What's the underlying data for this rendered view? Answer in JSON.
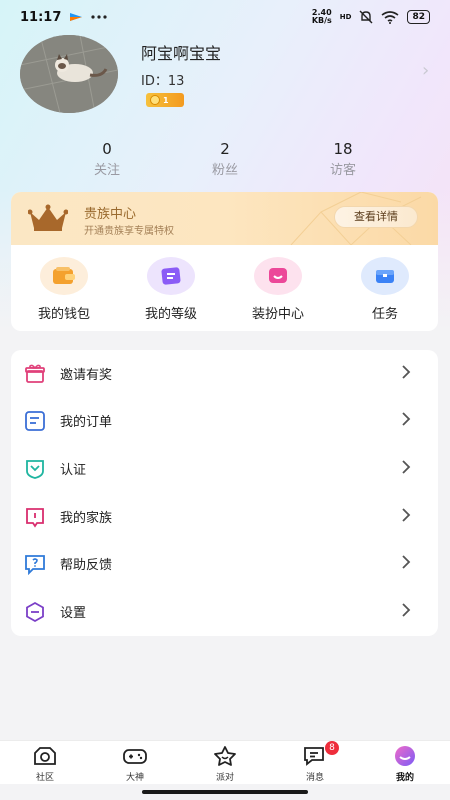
{
  "status_bar": {
    "time": "11:17",
    "net_speed": "2.40",
    "net_speed_unit": "KB/s",
    "network_type": "HD",
    "battery": "82",
    "icons": [
      "app-notification-icon",
      "more-icon",
      "mute-icon",
      "wifi-icon",
      "battery-icon"
    ]
  },
  "profile": {
    "username": "阿宝啊宝宝",
    "id_label": "ID：13",
    "level": "1"
  },
  "stats": [
    {
      "value": "0",
      "label": "关注"
    },
    {
      "value": "2",
      "label": "粉丝"
    },
    {
      "value": "18",
      "label": "访客"
    }
  ],
  "vip": {
    "title": "贵族中心",
    "subtitle": "开通贵族享专属特权",
    "button": "查看详情"
  },
  "features": [
    {
      "label": "我的钱包",
      "icon": "wallet-icon",
      "color": "#f39a2c"
    },
    {
      "label": "我的等级",
      "icon": "level-icon",
      "color": "#8b5cf6"
    },
    {
      "label": "装扮中心",
      "icon": "dress-up-icon",
      "color": "#ec4899"
    },
    {
      "label": "任务",
      "icon": "task-icon",
      "color": "#3b82f6"
    }
  ],
  "menu": [
    {
      "label": "邀请有奖",
      "icon": "gift-icon",
      "color": "#e0407a"
    },
    {
      "label": "我的订单",
      "icon": "order-icon",
      "color": "#3b6fd6"
    },
    {
      "label": "认证",
      "icon": "verify-icon",
      "color": "#1fb5a0"
    },
    {
      "label": "我的家族",
      "icon": "family-icon",
      "color": "#d92e6e"
    },
    {
      "label": "帮助反馈",
      "icon": "help-icon",
      "color": "#2f7ad9"
    },
    {
      "label": "设置",
      "icon": "settings-icon",
      "color": "#7b3fc7"
    }
  ],
  "bottom_nav": [
    {
      "label": "社区",
      "icon": "community-icon"
    },
    {
      "label": "大神",
      "icon": "gamepad-icon"
    },
    {
      "label": "派对",
      "icon": "party-icon"
    },
    {
      "label": "消息",
      "icon": "message-icon",
      "badge": "8"
    },
    {
      "label": "我的",
      "icon": "me-icon",
      "active": true
    }
  ]
}
